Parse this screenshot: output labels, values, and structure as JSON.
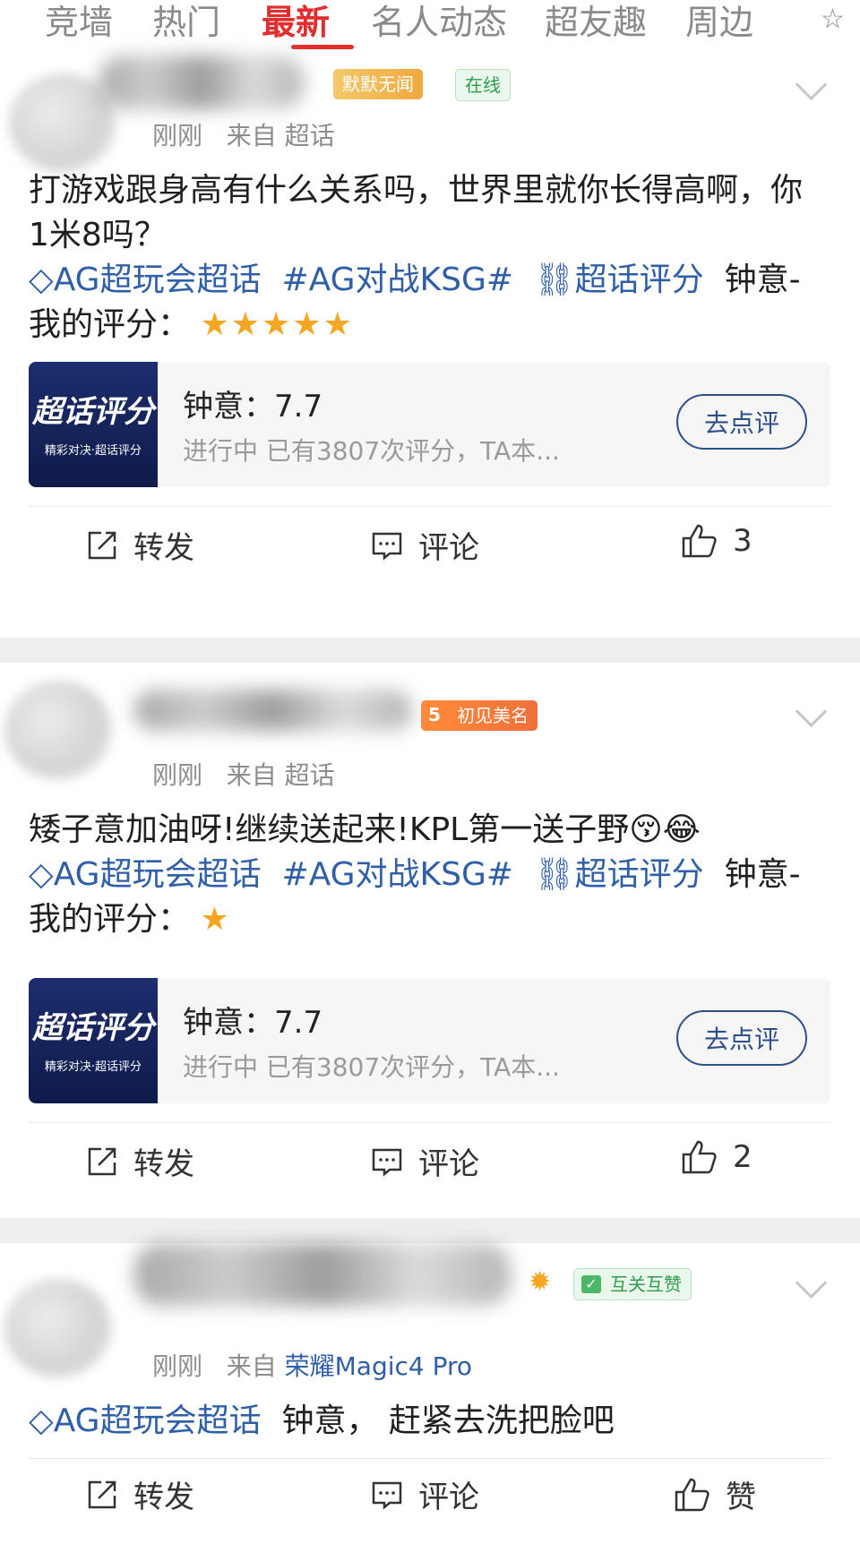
{
  "tabs": {
    "t1": "竞墙",
    "t2": "热门",
    "t3": "最新",
    "t4": "名人动态",
    "t5": "超友趣",
    "t6": "周边"
  },
  "actions": {
    "repost": "转发",
    "comment": "评论",
    "like_label": "赞"
  },
  "card": {
    "thumb_title": "超话评分",
    "thumb_sub": "精彩对决·超话评分",
    "title": "钟意：7.7",
    "sub": "进行中 已有3807次评分，TA本...",
    "button": "去点评"
  },
  "posts": [
    {
      "badge": "默默无闻",
      "status": "在线",
      "time": "刚刚",
      "source_prefix": "来自",
      "source": "超话",
      "text": "打游戏跟身高有什么关系吗，世界里就你长得高啊，你1米8吗？",
      "tag1": "AG超玩会超话",
      "tag2": "#AG对战KSG#",
      "tag3": "超话评分",
      "tail": "钟意-我的评分：",
      "stars": "★★★★★",
      "likes": "3"
    },
    {
      "badge": "初见美名",
      "badge_level": "5",
      "time": "刚刚",
      "source_prefix": "来自",
      "source": "超话",
      "text": "矮子意加油呀!继续送起来!KPL第一送子野😚😂",
      "tag1": "AG超玩会超话",
      "tag2": "#AG对战KSG#",
      "tag3": "超话评分",
      "tail": "钟意-我的评分：",
      "stars": "★",
      "likes": "2"
    },
    {
      "badge": "互关互赞",
      "time": "刚刚",
      "source_prefix": "来自",
      "source": "荣耀Magic4 Pro",
      "tag1": "AG超玩会超话",
      "text": "钟意， 赶紧去洗把脸吧"
    }
  ]
}
